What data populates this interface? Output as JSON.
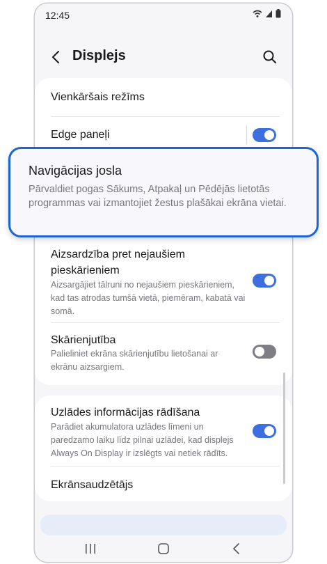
{
  "status_bar": {
    "time": "12:45",
    "icons": [
      "wifi-icon",
      "signal-icon",
      "battery-icon"
    ]
  },
  "app_bar": {
    "title": "Displejs",
    "back_icon": "chevron-left-icon",
    "search_icon": "search-icon"
  },
  "settings": {
    "simple_mode": {
      "label": "Vienkāršais režīms"
    },
    "edge_panels": {
      "label": "Edge paneļi",
      "toggle": "on"
    },
    "navigation_bar": {
      "label": "Navigācijas josla",
      "description": "Pārvaldiet pogas Sākums, Atpakaļ un Pēdējās lietotās programmas vai izmantojiet žestus plašākai ekrāna vietai."
    },
    "accidental_touch": {
      "label_line1": "Aizsardzība pret nejaušiem",
      "label_line2": "pieskārieniem",
      "description": "Aizsargājiet tālruni no nejaušiem pieskārieniem, kad tas atrodas tumšā vietā, piemēram, kabatā vai somā.",
      "toggle": "on"
    },
    "touch_sensitivity": {
      "label": "Skārienjutība",
      "description": "Palieliniet ekrāna skārienjutību lietošanai ar ekrānu aizsargiem.",
      "toggle": "off"
    },
    "charging_info": {
      "label": "Uzlādes informācijas rādīšana",
      "description": "Parādiet akumulatora uzlādes līmeni un paredzamo laiku līdz pilnai uzlādei, kad displejs Always On Display ir izslēgts vai netiek rādīts.",
      "toggle": "on"
    },
    "screen_saver": {
      "label": "Ekrānsaudzētājs"
    }
  },
  "nav_bar": {
    "recents_icon": "recents-icon",
    "home_icon": "home-icon",
    "back_icon": "back-icon"
  },
  "colors": {
    "accent": "#3e6fe0",
    "highlight_border": "#1b66d4",
    "background": "#f6f6f9"
  }
}
